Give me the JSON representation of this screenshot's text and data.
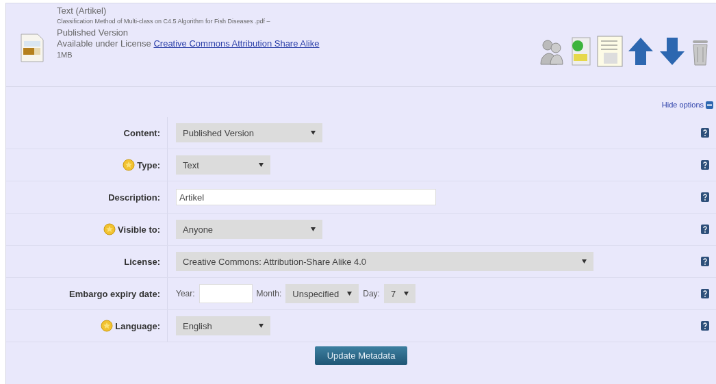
{
  "document": {
    "type_line": "Text (Artikel)",
    "filename": "Classification Method of Multi-class on C4.5 Algorithm for Fish Diseases .pdf –",
    "version": "Published Version",
    "license_prefix": "Available under License",
    "license_link": "Creative Commons Attribution Share Alike",
    "size": "1MB"
  },
  "options_toggle": "Hide options",
  "fields": [
    {
      "kind": "select",
      "label": "Content:",
      "required": false,
      "value": "Published Version"
    },
    {
      "kind": "select",
      "label": "Type:",
      "required": true,
      "value": "Text"
    },
    {
      "kind": "text",
      "label": "Description:",
      "required": false,
      "value": "Artikel"
    },
    {
      "kind": "select",
      "label": "Visible to:",
      "required": true,
      "value": "Anyone"
    },
    {
      "kind": "select",
      "label": "License:",
      "required": false,
      "value": "Creative Commons: Attribution-Share Alike 4.0"
    },
    {
      "kind": "date",
      "label": "Embargo expiry date:",
      "required": false,
      "year_label": "Year:",
      "month_label": "Month:",
      "month": "Unspecified",
      "day_label": "Day:",
      "day": "7"
    },
    {
      "kind": "select",
      "label": "Language:",
      "required": true,
      "value": "English"
    }
  ],
  "submit": "Update Metadata"
}
